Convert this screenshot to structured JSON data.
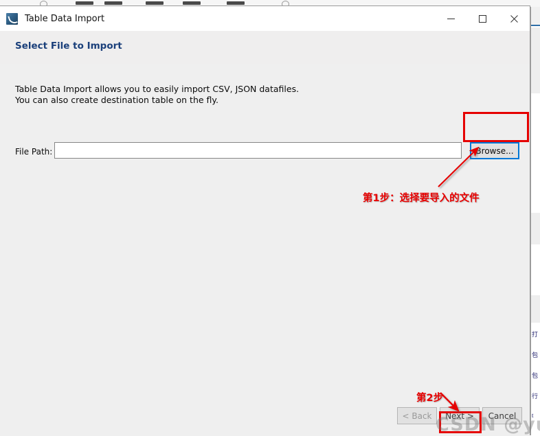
{
  "window": {
    "title": "Table Data Import",
    "icon": "mysql-workbench-icon",
    "controls": {
      "minimize": "minimize-icon",
      "maximize": "maximize-icon",
      "close": "close-icon"
    }
  },
  "header": {
    "heading": "Select File to Import",
    "heading_color": "#1a3f7a"
  },
  "body": {
    "description_line1": "Table Data Import allows you to easily import CSV, JSON datafiles.",
    "description_line2": "You can also create destination table on the fly.",
    "file_path": {
      "label": "File Path:",
      "value": "",
      "placeholder": ""
    },
    "browse_button": {
      "label": "Browse...",
      "focus_color": "#0078d7"
    }
  },
  "footer": {
    "back_button": "< Back",
    "next_button": "Next >",
    "cancel_button": "Cancel"
  },
  "annotations": {
    "accent_color": "#e50000",
    "step1_text": "第1步：选择要导入的文件",
    "step2_text": "第2步",
    "arrow_1": "red-arrow-to-browse",
    "arrow_2": "red-arrow-to-next"
  },
  "watermark": {
    "text": "CSDN @yuan晓"
  },
  "background": {
    "window_text_lines": [
      "打",
      "包",
      "包",
      "行",
      "t"
    ]
  }
}
